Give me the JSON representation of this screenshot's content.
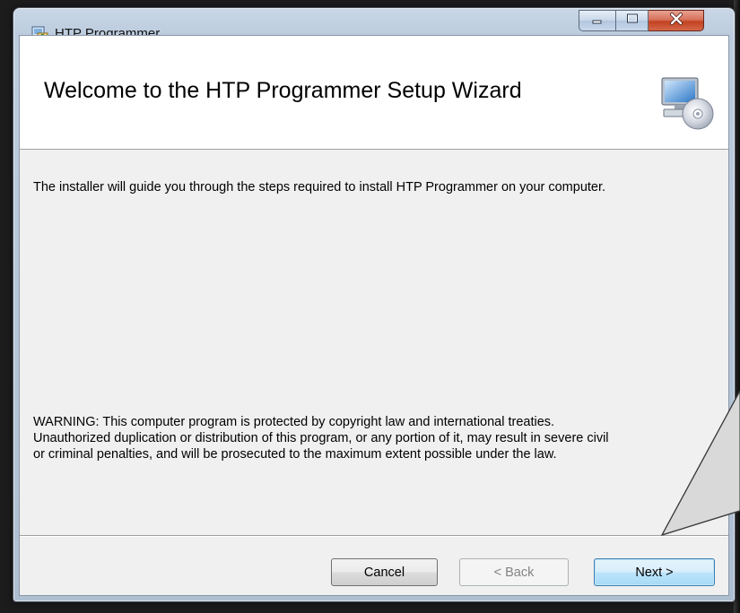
{
  "window": {
    "title": "HTP Programmer"
  },
  "header": {
    "title": "Welcome to the HTP Programmer Setup Wizard"
  },
  "body": {
    "intro": "The installer will guide you through the steps required to install HTP Programmer on your computer.",
    "warning_lines": [
      "WARNING: This computer program is protected by copyright law and international treaties.",
      "Unauthorized duplication or distribution of this program, or any portion of it, may result in severe civil",
      "or criminal penalties, and will be prosecuted to the maximum extent possible under the law."
    ]
  },
  "buttons": {
    "cancel": "Cancel",
    "back": "< Back",
    "next": "Next >"
  },
  "icons": {
    "app": "installer-package-icon",
    "header": "computer-cd-setup-icon",
    "minimize": "minimize-icon",
    "maximize": "maximize-icon",
    "close": "close-icon"
  },
  "colors": {
    "close_button": "#c2421f",
    "next_button_border": "#3c7fb1",
    "callout_fill": "#d9d9d9"
  },
  "states": {
    "back_enabled": false,
    "next_focused": true
  }
}
